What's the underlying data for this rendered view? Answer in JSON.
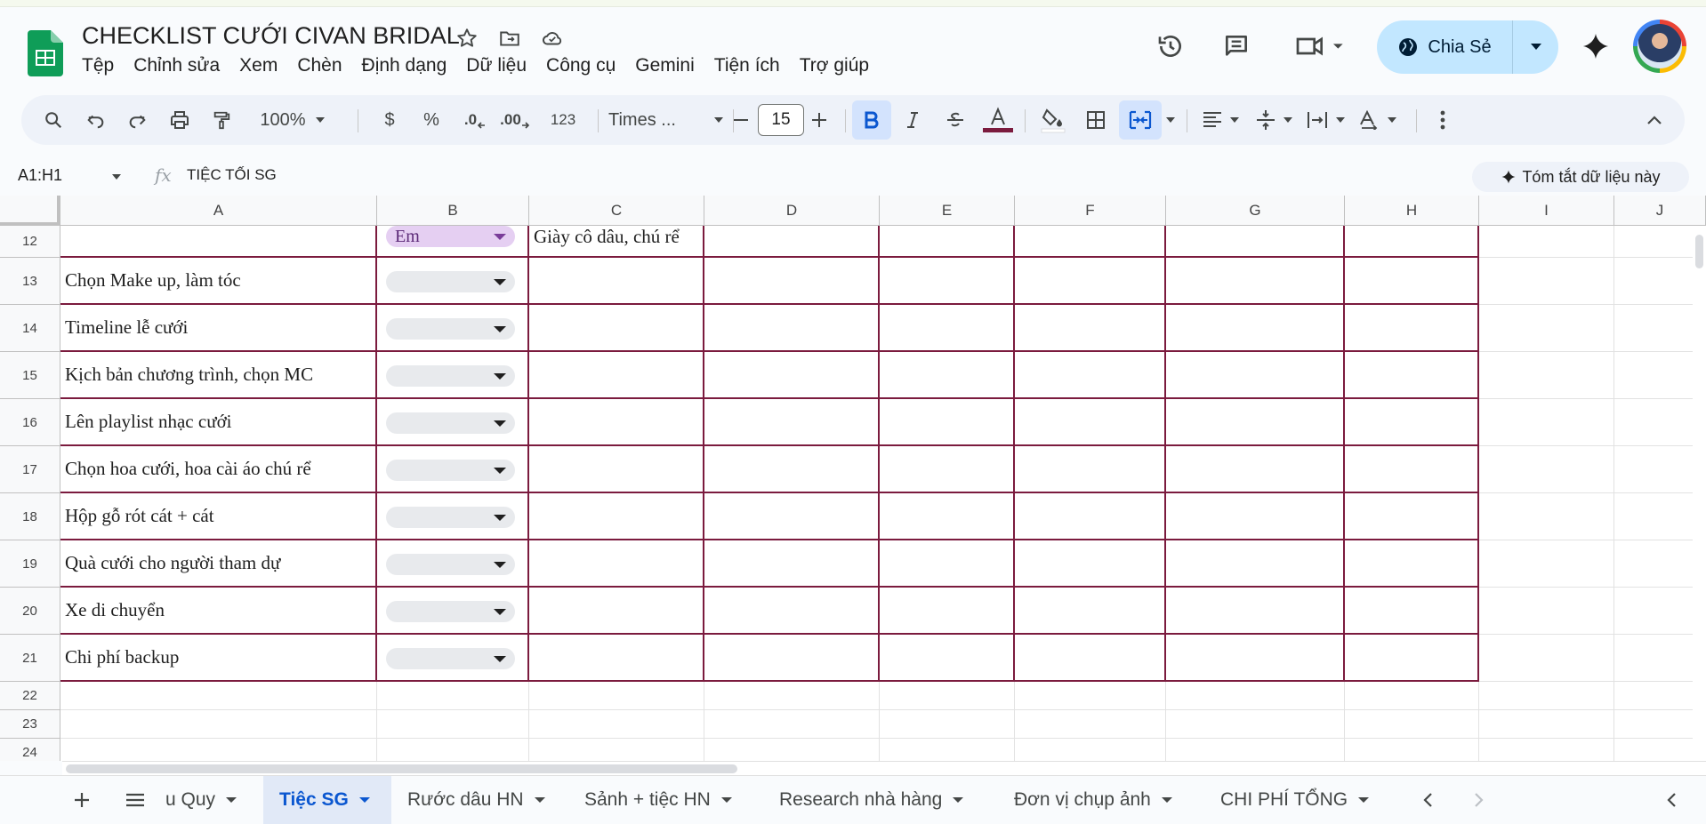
{
  "app": {
    "title": "CHECKLIST CƯỚI CIVAN BRIDAL"
  },
  "menu": [
    "Tệp",
    "Chỉnh sửa",
    "Xem",
    "Chèn",
    "Định dạng",
    "Dữ liệu",
    "Công cụ",
    "Gemini",
    "Tiện ích",
    "Trợ giúp"
  ],
  "share": {
    "label": "Chia Sẻ"
  },
  "toolbar": {
    "zoom": "100%",
    "currency": "$",
    "percent": "%",
    "dec_less": ".0",
    "dec_more": ".00",
    "number_format": "123",
    "font": "Times ...",
    "font_size": "15"
  },
  "formula_bar": {
    "name_box": "A1:H1",
    "fx": "fx",
    "content": "TIỆC TỐI SG",
    "summary_button": "Tóm tắt dữ liệu này"
  },
  "columns": [
    "A",
    "B",
    "C",
    "D",
    "E",
    "F",
    "G",
    "H",
    "I",
    "J"
  ],
  "rows": [
    {
      "num": "12",
      "a": "",
      "b": "Em",
      "c": "Giày cô dâu, chú rể"
    },
    {
      "num": "13",
      "a": "Chọn Make up, làm tóc",
      "b": "",
      "c": ""
    },
    {
      "num": "14",
      "a": "Timeline lễ cưới",
      "b": "",
      "c": ""
    },
    {
      "num": "15",
      "a": "Kịch bản chương trình, chọn MC",
      "b": "",
      "c": ""
    },
    {
      "num": "16",
      "a": "Lên playlist nhạc cưới",
      "b": "",
      "c": ""
    },
    {
      "num": "17",
      "a": "Chọn hoa cưới, hoa cài áo chú rể",
      "b": "",
      "c": ""
    },
    {
      "num": "18",
      "a": "Hộp gỗ rót cát + cát",
      "b": "",
      "c": ""
    },
    {
      "num": "19",
      "a": "Quà cưới cho người tham dự",
      "b": "",
      "c": ""
    },
    {
      "num": "20",
      "a": "Xe di chuyển",
      "b": "",
      "c": ""
    },
    {
      "num": "21",
      "a": "Chi phí backup",
      "b": "",
      "c": ""
    },
    {
      "num": "22",
      "a": "",
      "b": "",
      "c": ""
    },
    {
      "num": "23",
      "a": "",
      "b": "",
      "c": ""
    },
    {
      "num": "24",
      "a": "",
      "b": "",
      "c": ""
    }
  ],
  "sheet_tabs": [
    {
      "label": "u Quy",
      "active": false
    },
    {
      "label": "Tiệc SG",
      "active": true
    },
    {
      "label": "Rước dâu HN",
      "active": false
    },
    {
      "label": "Sảnh + tiệc HN",
      "active": false
    },
    {
      "label": "Research nhà hàng",
      "active": false
    },
    {
      "label": "Đơn vị chụp ảnh",
      "active": false
    },
    {
      "label": "CHI PHÍ TỔNG",
      "active": false
    }
  ],
  "colors": {
    "border": "#7b1b3e",
    "accent": "#0b57d0",
    "share_bg": "#c2e7ff",
    "chip_em": "#e5cff2"
  },
  "icons": [
    "sheets-logo-icon",
    "star-icon",
    "move-folder-icon",
    "cloud-icon",
    "history-icon",
    "comment-icon",
    "video-call-icon",
    "globe-icon",
    "gemini-spark-icon",
    "search-icon",
    "undo-icon",
    "redo-icon",
    "print-icon",
    "paint-format-icon",
    "text-color-icon",
    "fill-color-icon",
    "borders-icon",
    "merge-cells-icon",
    "align-left-icon",
    "valign-icon",
    "text-wrap-icon",
    "text-rotate-icon",
    "more-icon",
    "collapse-icon"
  ]
}
